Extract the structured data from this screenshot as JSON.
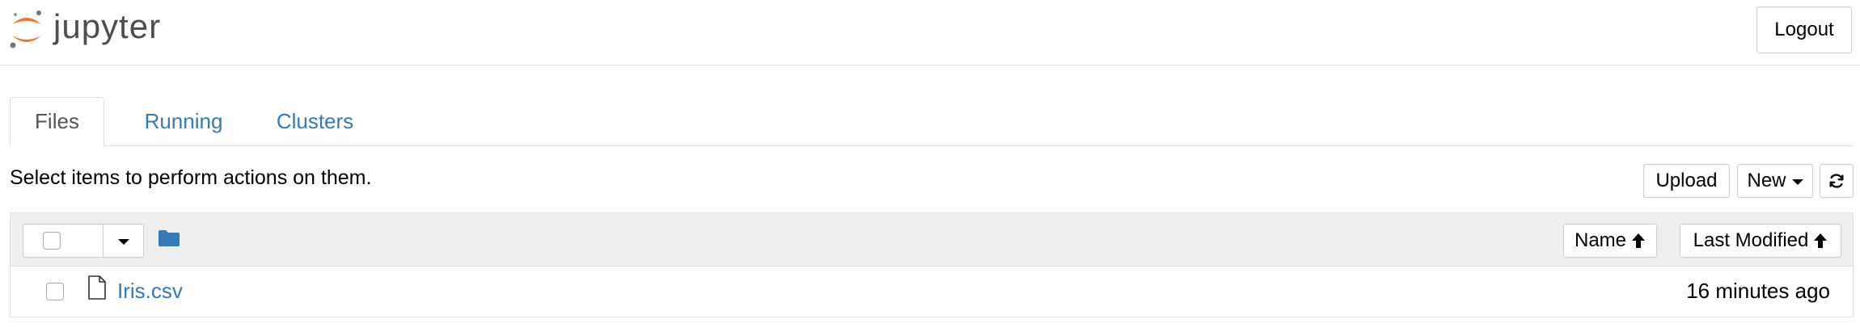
{
  "header": {
    "logo_text": "jupyter",
    "logout_label": "Logout",
    "logo_colors": {
      "arc": "#f37726",
      "text": "#4e4e4e",
      "dot": "#767677"
    }
  },
  "tabs": [
    {
      "label": "Files",
      "active": true
    },
    {
      "label": "Running",
      "active": false
    },
    {
      "label": "Clusters",
      "active": false
    }
  ],
  "toolbar": {
    "hint": "Select items to perform actions on them.",
    "upload_label": "Upload",
    "new_label": "New",
    "refresh_icon": "refresh-icon"
  },
  "list_header": {
    "folder_icon": "folder-icon",
    "sort_name_label": "Name",
    "sort_modified_label": "Last Modified"
  },
  "files": [
    {
      "name": "Iris.csv",
      "modified": "16 minutes ago",
      "icon": "file-icon"
    }
  ],
  "colors": {
    "link": "#337ab7",
    "folder": "#337ab7",
    "header_bg": "#eeeeee",
    "border": "#dddddd"
  }
}
